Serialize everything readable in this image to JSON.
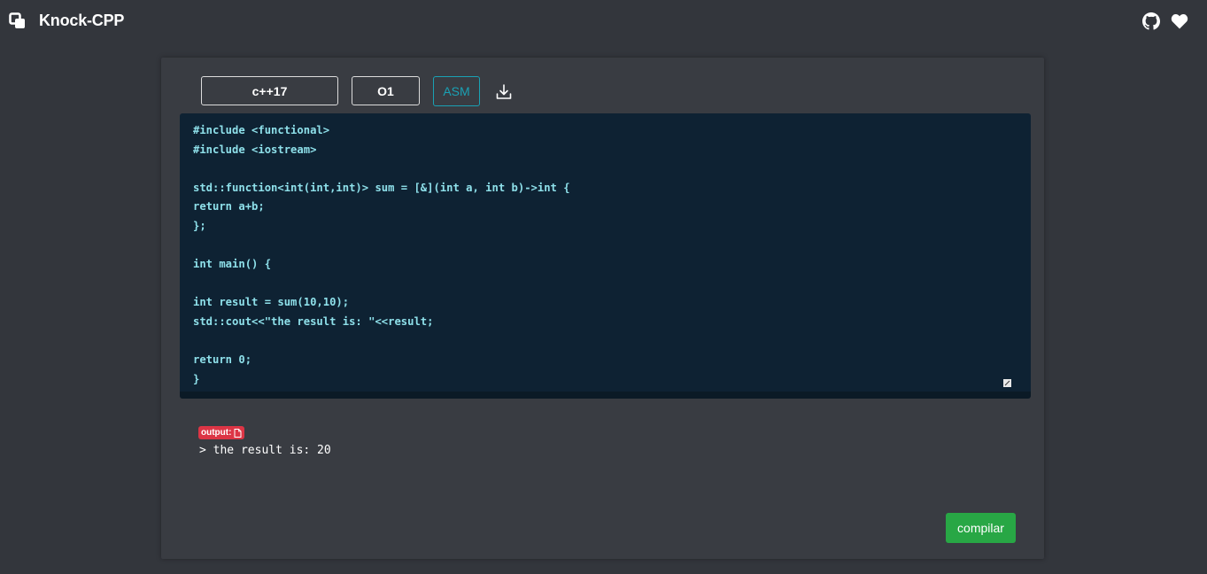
{
  "app": {
    "title": "Knock-CPP"
  },
  "header": {
    "icons": [
      "github-icon",
      "heart-icon"
    ]
  },
  "toolbar": {
    "standard_value": "c++17",
    "optimization_value": "O1",
    "asm_label": "ASM",
    "download_icon": "download-icon"
  },
  "editor": {
    "code": "#include <functional>\n#include <iostream>\n\nstd::function<int(int,int)> sum = [&](int a, int b)->int {\nreturn a+b;\n};\n\nint main() {\n\nint result = sum(10,10);\nstd::cout<<\"the result is: \"<<result;\n\nreturn 0;\n}"
  },
  "output": {
    "badge_label": "output:",
    "text": "> the result is: 20"
  },
  "actions": {
    "compile_label": "compilar"
  },
  "colors": {
    "background": "#33363c",
    "card": "#393c42",
    "editor": "#0e2233",
    "code_text": "#8ee0ea",
    "asm_accent": "#1aa1b4",
    "badge": "#dc3545",
    "compile": "#28a745"
  }
}
